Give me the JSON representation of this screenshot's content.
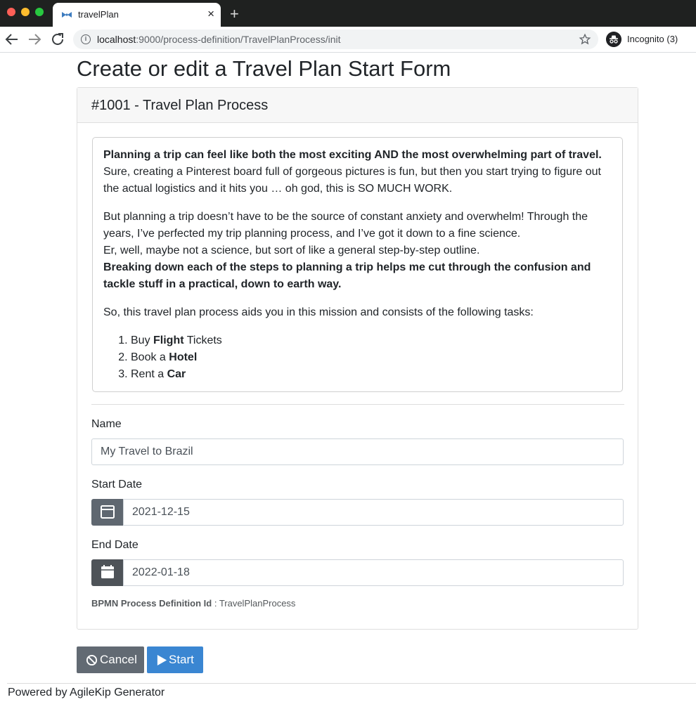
{
  "browser": {
    "tab_title": "travelPlan",
    "tab_close": "×",
    "new_tab": "+",
    "url_host": "localhost",
    "url_path": ":9000/process-definition/TravelPlanProcess/init",
    "incognito_label": "Incognito (3)"
  },
  "page": {
    "title": "Create or edit a Travel Plan Start Form",
    "card_header": "#1001 - Travel Plan Process",
    "description": {
      "p1_bold": "Planning a trip can feel like both the most exciting AND the most overwhelming part of travel.",
      "p1_rest": " Sure, creating a Pinterest board full of gorgeous pictures is fun, but then you start trying to figure out the actual logistics and it hits you … oh god, this is SO MUCH WORK.",
      "p2_a": "But planning a trip doesn’t have to be the source of constant anxiety and overwhelm! Through the years, I’ve perfected my trip planning process, and I’ve got it down to a fine science.",
      "p2_b": "Er, well, maybe not a science, but sort of like a general step-by-step outline.",
      "p2_bold": "Breaking down each of the steps to planning a trip helps me cut through the confusion and tackle stuff in a practical, down to earth way.",
      "p3": "So, this travel plan process aids you in this mission and consists of the following tasks:",
      "tasks": [
        {
          "pre": "Buy ",
          "bold": "Flight",
          "post": " Tickets"
        },
        {
          "pre": "Book a ",
          "bold": "Hotel",
          "post": ""
        },
        {
          "pre": "Rent a ",
          "bold": "Car",
          "post": ""
        }
      ]
    },
    "form": {
      "name_label": "Name",
      "name_value": "My Travel to Brazil",
      "start_label": "Start Date",
      "start_value": "2021-12-15",
      "end_label": "End Date",
      "end_value": "2022-01-18",
      "pid_label": "BPMN Process Definition Id",
      "pid_sep": " : ",
      "pid_value": "TravelPlanProcess"
    },
    "buttons": {
      "cancel": "Cancel",
      "start": "Start"
    },
    "footer": "Powered by AgileKip Generator"
  }
}
